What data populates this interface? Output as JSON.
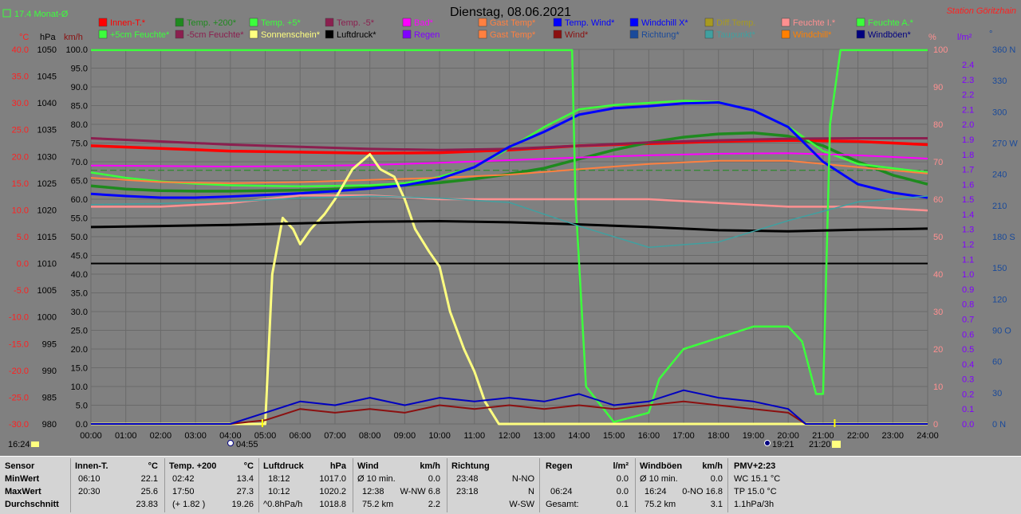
{
  "header": {
    "title": "Dienstag, 08.06.2021",
    "station": "Station Göritzhain",
    "monthly_avg": "17.4 Monat-Ø",
    "unit_c": "°C",
    "unit_hpa": "hPa",
    "unit_kmh": "km/h",
    "unit_pct": "%",
    "unit_lm2": "l/m²",
    "unit_deg": "°"
  },
  "legend": [
    {
      "label": "Innen-T.*",
      "color": "#ff0000"
    },
    {
      "label": "Temp. +200*",
      "color": "#1e8a1e"
    },
    {
      "label": "Temp. +5*",
      "color": "#3cff3c"
    },
    {
      "label": "Temp. -5*",
      "color": "#8b1f4f"
    },
    {
      "label": "Bad*",
      "color": "#ff00ff"
    },
    {
      "label": "Gast Temp*",
      "color": "#ff8040"
    },
    {
      "label": "Temp. Wind*",
      "color": "#0000ff"
    },
    {
      "label": "Windchill X*",
      "color": "#0000ff"
    },
    {
      "label": "Diff.Temp.",
      "color": "#a89a20"
    },
    {
      "label": "Feuchte I.*",
      "color": "#ff9090"
    },
    {
      "label": "Feuchte A.*",
      "color": "#3cff3c"
    },
    {
      "label": "+5cm Feuchte*",
      "color": "#3cff3c"
    },
    {
      "label": "-5cm Feuchte*",
      "color": "#8b1f4f"
    },
    {
      "label": "Sonnenschein*",
      "color": "#ffff80"
    },
    {
      "label": "Luftdruck*",
      "color": "#000000"
    },
    {
      "label": "Regen",
      "color": "#8000ff"
    },
    {
      "label": "Gast Temp*",
      "color": "#ff8040"
    },
    {
      "label": "Wind*",
      "color": "#8b1010"
    },
    {
      "label": "Richtung*",
      "color": "#1a4a9a"
    },
    {
      "label": "Taupunkt*",
      "color": "#40a0a0"
    },
    {
      "label": "Windchill*",
      "color": "#ff8000"
    },
    {
      "label": "Windböen*",
      "color": "#000080"
    }
  ],
  "axes": {
    "temp_ticks": [
      "40.0",
      "35.0",
      "30.0",
      "25.0",
      "20.0",
      "15.0",
      "10.0",
      "5.0",
      "0.0",
      "-5.0",
      "-10.0",
      "-15.0",
      "-20.0",
      "-25.0",
      "-30.0"
    ],
    "hpa_ticks": [
      "1050",
      "1045",
      "1040",
      "1035",
      "1030",
      "1025",
      "1020",
      "1015",
      "1010",
      "1005",
      "1000",
      "995",
      "990",
      "985",
      "980"
    ],
    "kmh_ticks": [
      "100.0",
      "95.0",
      "90.0",
      "85.0",
      "80.0",
      "75.0",
      "70.0",
      "65.0",
      "60.0",
      "55.0",
      "50.0",
      "45.0",
      "40.0",
      "35.0",
      "30.0",
      "25.0",
      "20.0",
      "15.0",
      "10.0",
      "5.0",
      "0.0"
    ],
    "pct_ticks": [
      "100",
      "90",
      "80",
      "70",
      "60",
      "50",
      "40",
      "30",
      "20",
      "10",
      "0"
    ],
    "rain_ticks": [
      "2.4",
      "2.3",
      "2.2",
      "2.1",
      "2.0",
      "1.9",
      "1.8",
      "1.7",
      "1.6",
      "1.5",
      "1.4",
      "1.3",
      "1.2",
      "1.1",
      "1.0",
      "0.9",
      "0.8",
      "0.7",
      "0.6",
      "0.5",
      "0.4",
      "0.3",
      "0.2",
      "0.1",
      "0.0"
    ],
    "dir_ticks": [
      "360 N",
      "330",
      "300",
      "270 W",
      "240",
      "210",
      "180 S",
      "150",
      "120",
      "90 O",
      "60",
      "30",
      "0 N"
    ],
    "time_ticks": [
      "00:00",
      "01:00",
      "02:00",
      "03:00",
      "04:00",
      "05:00",
      "06:00",
      "07:00",
      "08:00",
      "09:00",
      "10:00",
      "11:00",
      "12:00",
      "13:00",
      "14:00",
      "15:00",
      "16:00",
      "17:00",
      "18:00",
      "19:00",
      "20:00",
      "21:00",
      "22:00",
      "23:00",
      "24:00"
    ],
    "sunshine_duration": "16:24",
    "sunrise": "04:55",
    "sunset": "21:20",
    "moonset": "19:21"
  },
  "chart_data": {
    "type": "line",
    "title": "Dienstag, 08.06.2021",
    "x_unit": "hours",
    "xlim": [
      0,
      24
    ],
    "series": [
      {
        "name": "Innen-T.*",
        "unit": "°C",
        "x": [
          0,
          2,
          4,
          6,
          8,
          10,
          12,
          14,
          16,
          18,
          20,
          22,
          24
        ],
        "y": [
          22.0,
          21.5,
          21.0,
          20.8,
          20.6,
          20.7,
          21.2,
          22.0,
          22.4,
          22.8,
          23.0,
          22.8,
          22.2
        ]
      },
      {
        "name": "Temp. +200*",
        "unit": "°C",
        "x": [
          0,
          1,
          2,
          3,
          4,
          5,
          6,
          7,
          8,
          9,
          10,
          11,
          12,
          13,
          14,
          15,
          16,
          17,
          18,
          19,
          20,
          21,
          22,
          23,
          24
        ],
        "y": [
          14.5,
          13.9,
          13.6,
          13.5,
          13.5,
          13.6,
          13.7,
          13.9,
          14.2,
          14.6,
          15.1,
          15.8,
          16.7,
          17.8,
          19.5,
          21.2,
          22.6,
          23.6,
          24.2,
          24.4,
          23.8,
          22.0,
          19.0,
          16.5,
          14.8
        ]
      },
      {
        "name": "Temp. +5*",
        "unit": "°C",
        "x": [
          0,
          1,
          2,
          3,
          4,
          5,
          6,
          7,
          8,
          9,
          10,
          11,
          12,
          13,
          14,
          15,
          16,
          17,
          18,
          19,
          20,
          21,
          22,
          23,
          24
        ],
        "y": [
          17.0,
          16.0,
          15.3,
          14.9,
          14.6,
          14.5,
          14.4,
          14.5,
          14.6,
          15.0,
          16.2,
          18.0,
          21.5,
          25.5,
          28.8,
          29.6,
          30.0,
          30.4,
          30.2,
          28.6,
          25.6,
          21.0,
          18.6,
          17.8,
          17.0
        ]
      },
      {
        "name": "Temp. -5*",
        "unit": "°C",
        "x": [
          0,
          2,
          4,
          6,
          8,
          10,
          12,
          14,
          16,
          18,
          20,
          22,
          24
        ],
        "y": [
          23.4,
          22.8,
          22.2,
          21.8,
          21.4,
          21.2,
          21.4,
          22.0,
          22.6,
          23.0,
          23.3,
          23.4,
          23.4
        ]
      },
      {
        "name": "Bad*",
        "unit": "°C",
        "x": [
          0,
          2,
          4,
          6,
          8,
          10,
          12,
          14,
          16,
          18,
          20,
          22,
          24
        ],
        "y": [
          18.3,
          18.2,
          18.1,
          18.2,
          18.4,
          18.8,
          19.3,
          19.8,
          20.2,
          20.5,
          20.6,
          20.2,
          19.6
        ]
      },
      {
        "name": "Gast Temp*",
        "unit": "°C",
        "x": [
          0,
          2,
          4,
          6,
          8,
          10,
          12,
          14,
          16,
          18,
          20,
          22,
          24
        ],
        "y": [
          16.0,
          15.2,
          15.0,
          15.2,
          15.6,
          16.0,
          16.6,
          17.6,
          18.6,
          19.2,
          19.2,
          18.0,
          16.8
        ]
      },
      {
        "name": "Temp. Wind*",
        "unit": "°C",
        "x": [
          0,
          1,
          2,
          3,
          4,
          5,
          6,
          7,
          8,
          9,
          10,
          11,
          12,
          13,
          14,
          15,
          16,
          17,
          18,
          19,
          20,
          21,
          22,
          23,
          24
        ],
        "y": [
          13.0,
          12.6,
          12.3,
          12.3,
          12.5,
          12.8,
          13.1,
          13.5,
          14.0,
          14.6,
          15.8,
          18.0,
          21.8,
          24.6,
          27.8,
          29.0,
          29.4,
          29.9,
          30.1,
          28.6,
          25.5,
          19.0,
          14.8,
          13.2,
          12.3
        ]
      },
      {
        "name": "Feuchte I.*",
        "unit": "%",
        "x": [
          0,
          2,
          4,
          6,
          8,
          10,
          12,
          14,
          16,
          18,
          20,
          22,
          24
        ],
        "y": [
          58,
          58,
          59,
          61,
          61,
          60,
          60,
          60,
          60,
          59,
          58,
          58,
          57
        ]
      },
      {
        "name": "Feuchte A.*",
        "unit": "%",
        "x": [
          0,
          13.8,
          13.9,
          14.2,
          15,
          16,
          16.3,
          17,
          18,
          19,
          20,
          20.4,
          20.8,
          21,
          21.2,
          21.5,
          24
        ],
        "y": [
          99.8,
          99.8,
          60,
          10,
          0.5,
          3,
          12,
          20,
          23,
          26,
          26,
          22,
          8,
          8,
          80,
          99.8,
          99.8
        ]
      },
      {
        "name": "Sonnenschein*",
        "unit": "min",
        "x": [
          0,
          5.0,
          5.2,
          5.5,
          5.8,
          6.0,
          6.3,
          6.7,
          7.0,
          7.5,
          8.0,
          8.3,
          8.7,
          9.0,
          9.3,
          9.7,
          10.0,
          10.3,
          10.7,
          11.0,
          11.3,
          11.7,
          12,
          24
        ],
        "y": [
          0,
          0,
          40,
          55,
          52,
          48,
          52,
          56,
          60,
          68,
          72,
          68,
          66,
          60,
          52,
          46,
          42,
          30,
          20,
          14,
          6,
          0,
          0,
          0
        ]
      },
      {
        "name": "Luftdruck*",
        "unit": "hPa",
        "x": [
          0,
          2,
          4,
          6,
          8,
          10,
          12,
          14,
          16,
          18,
          20,
          22,
          24
        ],
        "y": [
          1016.8,
          1017.0,
          1017.2,
          1017.5,
          1017.8,
          1017.9,
          1017.7,
          1017.3,
          1016.8,
          1016.2,
          1016.0,
          1016.3,
          1016.5
        ]
      },
      {
        "name": "Wind*",
        "unit": "km/h",
        "x": [
          0,
          4,
          5,
          6,
          7,
          8,
          9,
          10,
          11,
          12,
          13,
          14,
          15,
          16,
          17,
          18,
          19,
          20,
          20.5,
          24
        ],
        "y": [
          0,
          0,
          1,
          4,
          3,
          4,
          3,
          5,
          4,
          5,
          4,
          5,
          4,
          5,
          6,
          5,
          4,
          3,
          0,
          0
        ]
      },
      {
        "name": "Windböen*",
        "unit": "km/h",
        "x": [
          0,
          4,
          5,
          6,
          7,
          8,
          9,
          10,
          11,
          12,
          13,
          14,
          15,
          16,
          17,
          18,
          19,
          20,
          20.5,
          24
        ],
        "y": [
          0,
          0,
          3,
          6,
          5,
          7,
          5,
          7,
          6,
          7,
          6,
          8,
          5,
          6,
          9,
          7,
          6,
          4,
          0,
          0
        ]
      },
      {
        "name": "Taupunkt*",
        "unit": "°C",
        "x": [
          0,
          2,
          4,
          6,
          8,
          10,
          12,
          14,
          16,
          18,
          20,
          22,
          24
        ],
        "y": [
          11.0,
          11.2,
          11.6,
          12.2,
          12.6,
          12.2,
          11.4,
          7.0,
          3.0,
          4.0,
          8.0,
          11.5,
          12.6
        ]
      }
    ]
  },
  "stats": {
    "labels": {
      "sensor": "Sensor",
      "min": "MinWert",
      "max": "MaxWert",
      "avg": "Durchschnitt"
    },
    "innen": {
      "title": "Innen-T.",
      "unit": "°C",
      "min_t": "06:10",
      "min_v": "22.1",
      "max_t": "20:30",
      "max_v": "25.6",
      "avg": "23.83"
    },
    "temp200": {
      "title": "Temp. +200",
      "unit": "°C",
      "min_t": "02:42",
      "min_v": "13.4",
      "max_t": "17:50",
      "max_v": "27.3",
      "avg_note": "(+ 1.82 )",
      "avg": "19.26"
    },
    "luftdruck": {
      "title": "Luftdruck",
      "unit": "hPa",
      "min_t": "18:12",
      "min_v": "1017.0",
      "max_t": "10:12",
      "max_v": "1020.2",
      "avg_note": "^0.8hPa/h",
      "avg": "1018.8"
    },
    "wind": {
      "title": "Wind",
      "unit": "km/h",
      "r1_l": "Ø 10 min.",
      "r1_v": "0.0",
      "r2_l": "12:38",
      "r2_m": "W-NW 6.8",
      "r3_l": "75.2 km",
      "r3_v": "2.2"
    },
    "richtung": {
      "title": "Richtung",
      "r1_l": "23:48",
      "r1_v": "N-NO",
      "r2_l": "23:18",
      "r2_v": "N",
      "r3_v": "W-SW"
    },
    "regen": {
      "title": "Regen",
      "unit": "l/m²",
      "r1_v": "0.0",
      "r2_l": "06:24",
      "r2_v": "0.0",
      "r3_l": "Gesamt:",
      "r3_v": "0.1"
    },
    "boeen": {
      "title": "Windböen",
      "unit": "km/h",
      "r1_l": "Ø 10 min.",
      "r1_v": "0.0",
      "r2_l": "16:24",
      "r2_m": "0-NO 16.8",
      "r3_l": "75.2 km",
      "r3_v": "3.1"
    },
    "pmv": {
      "title": "PMV+2:23",
      "r1": "WC 15.1 °C",
      "r2": "TP 15.0 °C",
      "r3": "1.1hPa/3h"
    }
  }
}
